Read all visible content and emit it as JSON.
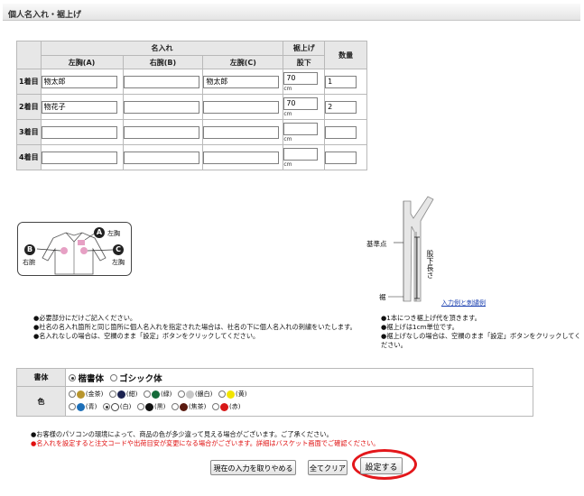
{
  "page_title": "個人名入れ・裾上げ",
  "table": {
    "header_name": "名入れ",
    "header_hem": "裾上げ",
    "header_qty": "数量",
    "col_left_chest_a": "左胸(A)",
    "col_right_arm_b": "右腕(B)",
    "col_left_arm_c": "左腕(C)",
    "col_inseam": "股下",
    "unit": "cm",
    "rows": [
      {
        "label": "1着目",
        "a": "物太郎",
        "b": "",
        "c": "物太郎",
        "inseam": "70",
        "qty": "1"
      },
      {
        "label": "2着目",
        "a": "物花子",
        "b": "",
        "c": "",
        "inseam": "70",
        "qty": "2"
      },
      {
        "label": "3着目",
        "a": "",
        "b": "",
        "c": "",
        "inseam": "",
        "qty": ""
      },
      {
        "label": "4着目",
        "a": "",
        "b": "",
        "c": "",
        "inseam": "",
        "qty": ""
      }
    ]
  },
  "diagram_shirt": {
    "badge_a": "A",
    "badge_b": "B",
    "badge_c": "C",
    "label_left_chest": "左胸",
    "label_right_arm": "右腕",
    "label_left_arm": "左胸"
  },
  "diagram_pants": {
    "label_base": "基準点",
    "label_hem": "裾",
    "label_inseam_length": "股下長さ",
    "link_examples": "入力例と刺繍例"
  },
  "notes_left": [
    "●必要部分にだけご記入ください。",
    "●社名の名入れ箇所と同じ箇所に個人名入れを指定された場合は、社名の下に個人名入れの刺繍をいたします。",
    "●名入れなしの場合は、空欄のまま「設定」ボタンをクリックしてください。"
  ],
  "notes_right": [
    "●1本につき裾上げ代を頂きます。",
    "●裾上げは1cm単位です。",
    "●裾上げなしの場合は、空欄のまま「設定」ボタンをクリックしてください。"
  ],
  "font_row": {
    "label": "書体",
    "option_kaisho": "楷書体",
    "option_gothic": "ゴシック体",
    "selected": "kaisho"
  },
  "color_row": {
    "label": "色",
    "options": [
      {
        "label": "(金茶)",
        "color": "#b8952d",
        "selected": false
      },
      {
        "label": "(紺)",
        "color": "#1c2350",
        "selected": false
      },
      {
        "label": "(緑)",
        "color": "#156b3a",
        "selected": false
      },
      {
        "label": "(銀白)",
        "color": "#c8c8c8",
        "selected": false
      },
      {
        "label": "(黄)",
        "color": "#f2e400",
        "selected": false
      },
      {
        "label": "(青)",
        "color": "#1d6fb8",
        "selected": false
      },
      {
        "label": "(白)",
        "color": "#ffffff",
        "selected": true
      },
      {
        "label": "(黒)",
        "color": "#111111",
        "selected": false
      },
      {
        "label": "(焦茶)",
        "color": "#5a1a10",
        "selected": false
      },
      {
        "label": "(赤)",
        "color": "#d81818",
        "selected": false
      }
    ]
  },
  "footer_notes": {
    "line1": "●お客様のパソコンの環境によって、商品の色が多少違って見える場合がございます。ご了承ください。",
    "line2": "●名入れを設定すると注文コードや出荷目安が変更になる場合がございます。詳細はバスケット画面でご確認ください。"
  },
  "buttons": {
    "remove_current": "現在の入力を取りやめる",
    "clear_all": "全てクリア",
    "set": "設定する"
  },
  "colors": {
    "accent_red": "#e01010",
    "highlight_ring": "#e3171b",
    "badge_pink": "#e6a0c4"
  }
}
